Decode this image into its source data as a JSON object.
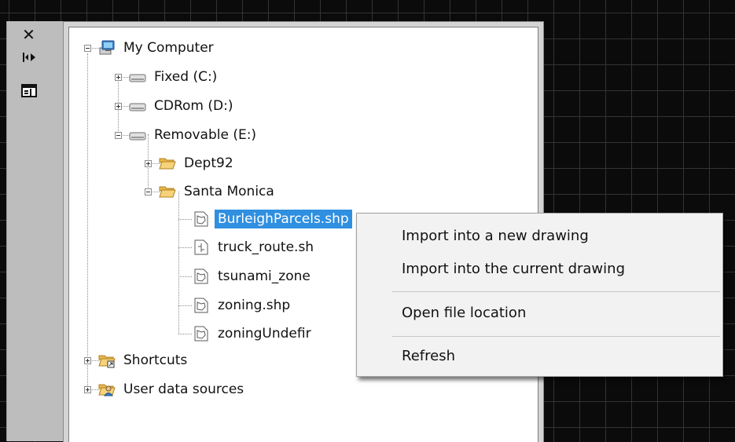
{
  "palette": {
    "close_icon": "close-icon",
    "autohide_icon": "auto-hide-icon",
    "properties_icon": "properties-icon"
  },
  "tree": {
    "root": {
      "label": "My Computer",
      "icon": "computer-icon"
    },
    "drives": [
      {
        "label": "Fixed (C:)",
        "expanded": false,
        "icon": "drive-icon"
      },
      {
        "label": "CDRom (D:)",
        "expanded": false,
        "icon": "drive-icon"
      },
      {
        "label": "Removable (E:)",
        "expanded": true,
        "icon": "drive-icon"
      }
    ],
    "folders": [
      {
        "label": "Dept92",
        "expanded": false,
        "icon": "folder-icon"
      },
      {
        "label": "Santa Monica",
        "expanded": true,
        "icon": "folder-open-icon"
      }
    ],
    "files": [
      {
        "label": "BurleighParcels.shp",
        "selected": true,
        "icon": "polygon-file-icon"
      },
      {
        "label": "truck_route.sh",
        "selected": false,
        "icon": "line-file-icon"
      },
      {
        "label": "tsunami_zone",
        "selected": false,
        "icon": "polygon-file-icon"
      },
      {
        "label": "zoning.shp",
        "selected": false,
        "icon": "polygon-file-icon"
      },
      {
        "label": "zoningUndefir",
        "selected": false,
        "icon": "polygon-file-icon"
      }
    ],
    "shortcuts": {
      "label": "Shortcuts",
      "icon": "shortcut-folder-icon"
    },
    "user_data_sources": {
      "label": "User data sources",
      "icon": "user-folder-icon"
    }
  },
  "context_menu": {
    "items": [
      "Import into a new drawing",
      "Import into the current drawing",
      "Open file location",
      "Refresh"
    ]
  },
  "colors": {
    "selection": "#2f8fe0",
    "canvas": "#0b0b0b",
    "menu_bg": "#f2f2f2"
  }
}
